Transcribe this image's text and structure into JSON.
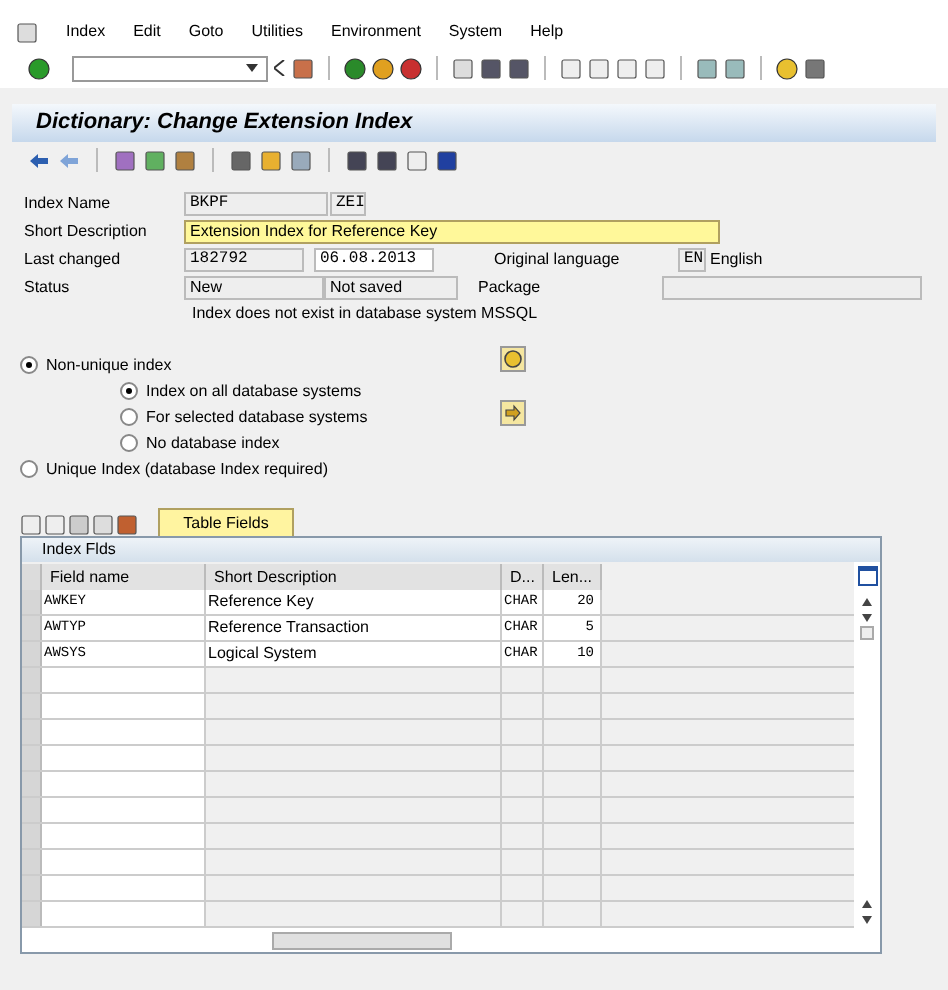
{
  "menu": [
    "Index",
    "Edit",
    "Goto",
    "Utilities",
    "Environment",
    "System",
    "Help"
  ],
  "title": "Dictionary: Change Extension Index",
  "form": {
    "index_name": {
      "label": "Index Name",
      "table": "BKPF",
      "id": "ZEI"
    },
    "short_description": {
      "label": "Short Description",
      "value": "Extension Index for Reference Key"
    },
    "last_changed": {
      "label": "Last changed",
      "user": "182792",
      "date": "06.08.2013"
    },
    "original_language": {
      "label": "Original language",
      "code": "EN",
      "name": "English"
    },
    "status": {
      "label": "Status",
      "value": "New",
      "save_state": "Not saved"
    },
    "package": {
      "label": "Package"
    },
    "message": "Index does not exist in database system MSSQL"
  },
  "index_type": [
    {
      "label": "Non-unique index",
      "selected": true,
      "children": [
        {
          "label": "Index on all database systems",
          "selected": true
        },
        {
          "label": "For selected database systems",
          "selected": false
        },
        {
          "label": "No database index",
          "selected": false
        }
      ]
    },
    {
      "label": "Unique Index (database Index required)",
      "selected": false
    }
  ],
  "tab": "Table Fields",
  "table": {
    "title": "Index Flds",
    "columns": [
      "Field name",
      "Short Description",
      "D...",
      "Len..."
    ],
    "rows": [
      [
        "AWKEY",
        "Reference Key",
        "CHAR",
        "20"
      ],
      [
        "AWTYP",
        "Reference Transaction",
        "CHAR",
        "5"
      ],
      [
        "AWSYS",
        "Logical System",
        "CHAR",
        "10"
      ]
    ]
  }
}
